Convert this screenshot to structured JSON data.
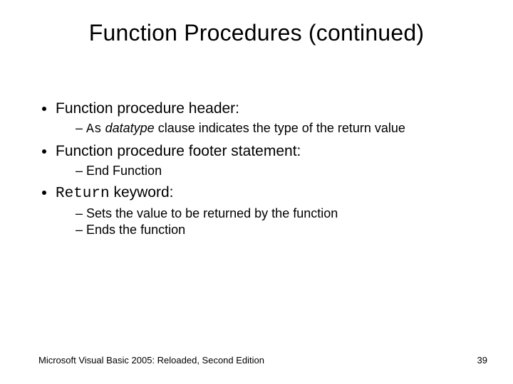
{
  "title": "Function Procedures (continued)",
  "bullets": {
    "b1": "Function procedure header:",
    "b1_sub1_code": "As",
    "b1_sub1_italic": " datatype",
    "b1_sub1_rest": " clause indicates the type of the return value",
    "b2": "Function procedure footer statement:",
    "b2_sub1": "End Function",
    "b3_code": "Return",
    "b3_rest": " keyword:",
    "b3_sub1": "Sets the value to be returned by the function",
    "b3_sub2": "Ends the function"
  },
  "footer": {
    "left": "Microsoft Visual Basic 2005: Reloaded, Second Edition",
    "right": "39"
  }
}
